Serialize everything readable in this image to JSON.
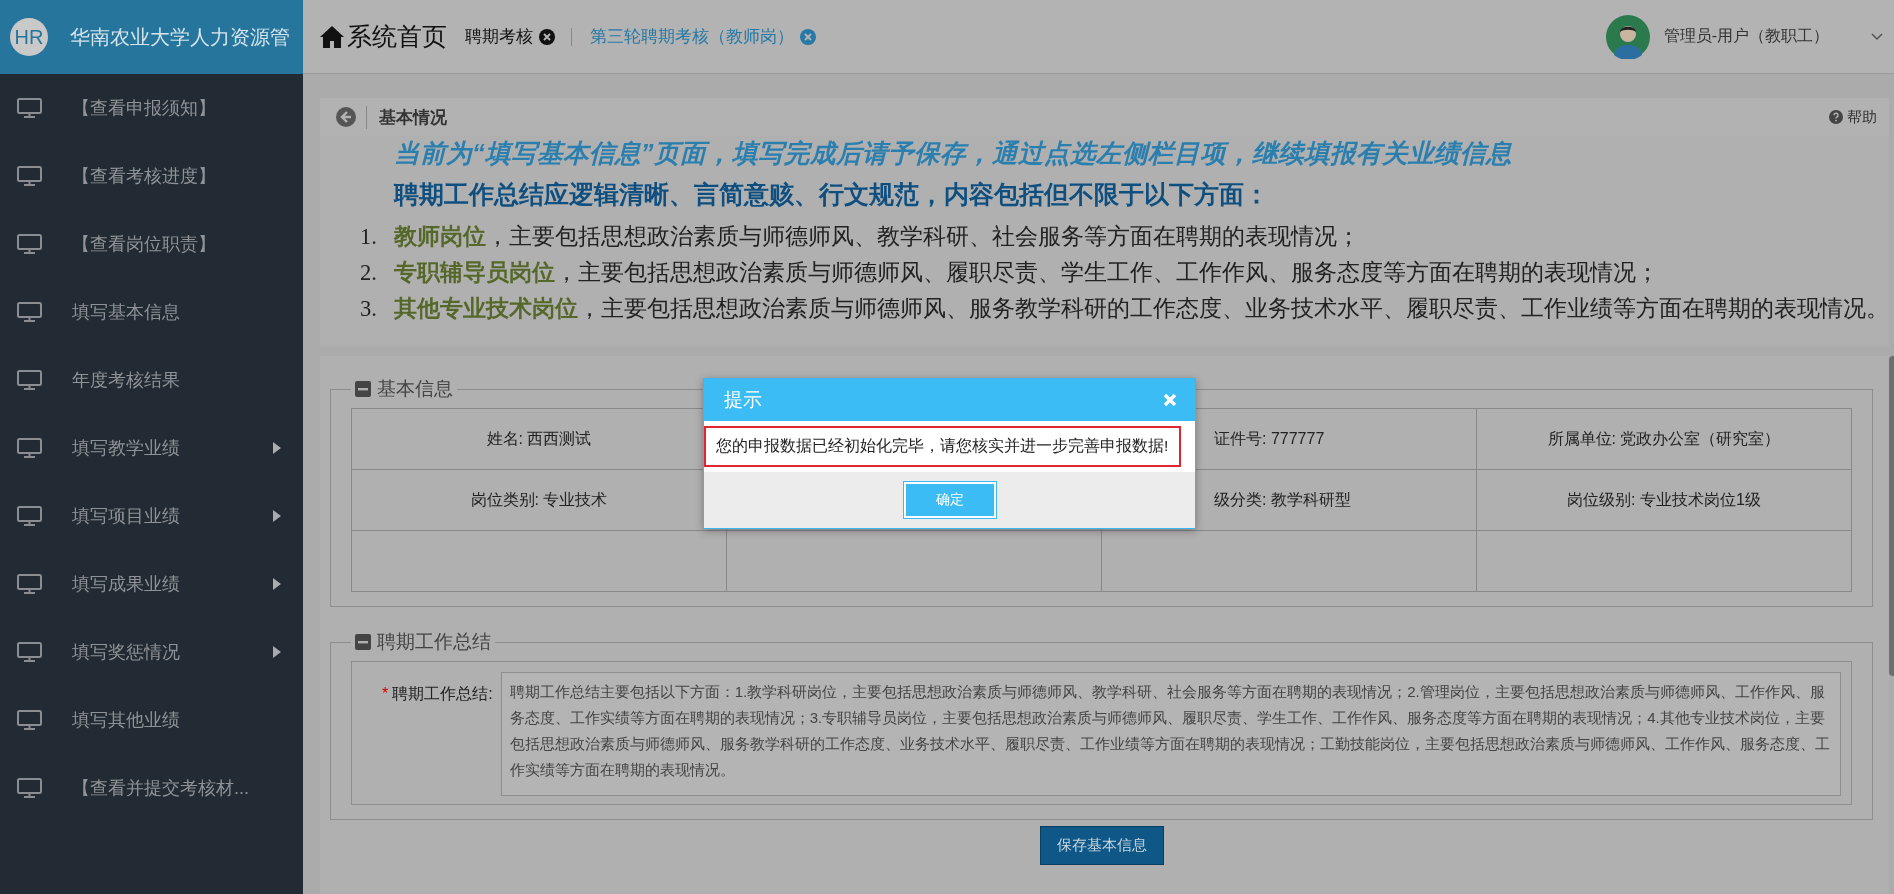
{
  "brand": {
    "logo": "HR",
    "title": "华南农业大学人力资源管"
  },
  "nav": {
    "home": "系统首页",
    "tabs": [
      {
        "label": "聘期考核",
        "selected": false
      },
      {
        "label": "第三轮聘期考核（教师岗）",
        "selected": true
      }
    ]
  },
  "user": {
    "name": "管理员-用户（教职工）"
  },
  "sidebar": {
    "items": [
      {
        "label": "【查看申报须知】",
        "has_submenu": false
      },
      {
        "label": "【查看考核进度】",
        "has_submenu": false
      },
      {
        "label": "【查看岗位职责】",
        "has_submenu": false
      },
      {
        "label": "填写基本信息",
        "has_submenu": false
      },
      {
        "label": "年度考核结果",
        "has_submenu": false
      },
      {
        "label": "填写教学业绩",
        "has_submenu": true
      },
      {
        "label": "填写项目业绩",
        "has_submenu": true
      },
      {
        "label": "填写成果业绩",
        "has_submenu": true
      },
      {
        "label": "填写奖惩情况",
        "has_submenu": true
      },
      {
        "label": "填写其他业绩",
        "has_submenu": false
      },
      {
        "label": "【查看并提交考核材...",
        "has_submenu": false
      }
    ]
  },
  "breadcrumb": {
    "title": "基本情况",
    "help": "帮助"
  },
  "notice": {
    "hint": "当前为“填写基本信息”页面，填写完成后请予保存，通过点选左侧栏目项，继续填报有关业绩信息",
    "heading": "聘期工作总结应逻辑清晰、言简意赅、行文规范，内容包括但不限于以下方面：",
    "items": [
      {
        "number": "1.",
        "role": "教师岗位",
        "text": "，主要包括思想政治素质与师德师风、教学科研、社会服务等方面在聘期的表现情况；"
      },
      {
        "number": "2.",
        "role": "专职辅导员岗位",
        "text": "，主要包括思想政治素质与师德师风、履职尽责、学生工作、工作作风、服务态度等方面在聘期的表现情况；"
      },
      {
        "number": "3.",
        "role": "其他专业技术岗位",
        "text": "，主要包括思想政治素质与师德师风、服务教学科研的工作态度、业务技术水平、履职尽责、工作业绩等方面在聘期的表现情况。"
      }
    ]
  },
  "basic_info": {
    "legend": "基本信息",
    "rows": [
      {
        "column_1": "姓名: 西西测试",
        "column_3": "证件号: 777777",
        "column_4": "所属单位: 党政办公室（研究室）"
      },
      {
        "column_1": "岗位类别: 专业技术",
        "column_3": "级分类: 教学科研型",
        "column_4": "岗位级别: 专业技术岗位1级"
      },
      {}
    ]
  },
  "summary": {
    "legend": "聘期工作总结",
    "label": "聘期工作总结:",
    "required_mark": "*",
    "value": "聘期工作总结主要包括以下方面：1.教学科研岗位，主要包括思想政治素质与师德师风、教学科研、社会服务等方面在聘期的表现情况；2.管理岗位，主要包括思想政治素质与师德师风、工作作风、服务态度、工作实绩等方面在聘期的表现情况；3.专职辅导员岗位，主要包括思想政治素质与师德师风、履职尽责、学生工作、工作作风、服务态度等方面在聘期的表现情况；4.其他专业技术岗位，主要包括思想政治素质与师德师风、服务教学科研的工作态度、业务技术水平、履职尽责、工作业绩等方面在聘期的表现情况；工勤技能岗位，主要包括思想政治素质与师德师风、工作作风、服务态度、工作实绩等方面在聘期的表现情况。"
  },
  "save_button": "保存基本信息",
  "dialog": {
    "title": "提示",
    "message": "您的申报数据已经初始化完毕，请您核实并进一步完善申报数据!",
    "confirm": "确定"
  }
}
